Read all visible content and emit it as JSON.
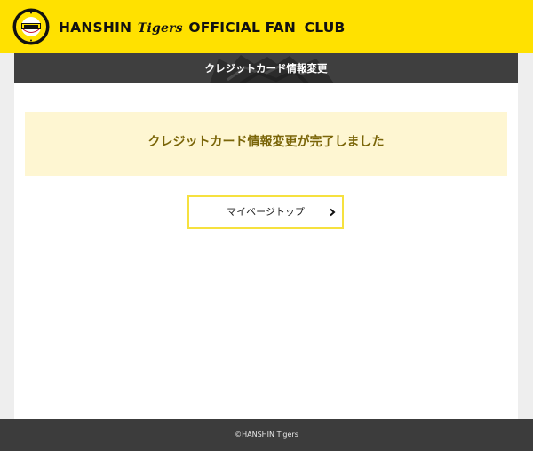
{
  "header": {
    "brand_part1": "HANSHIN",
    "brand_part2": "Tigers",
    "brand_part3": "OFFICIAL FAN",
    "brand_part4": "CLUB",
    "logo_icon": "hanshin-tigers-emblem-icon",
    "background_color": "#ffe100"
  },
  "page": {
    "title": "クレジットカード情報変更",
    "completion_message": "クレジットカード情報変更が完了しました",
    "mypage_button_label": "マイページトップ",
    "chevron_icon": "chevron-right-icon",
    "accent_color": "#f6e13f"
  },
  "footer": {
    "copyright": "©HANSHIN Tigers"
  }
}
